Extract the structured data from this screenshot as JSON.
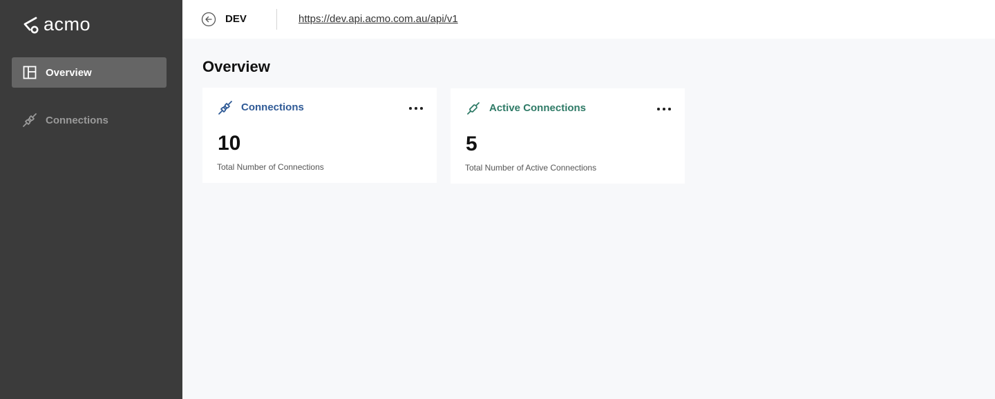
{
  "app": {
    "logo_text": "acmo"
  },
  "sidebar": {
    "items": [
      {
        "label": "Overview",
        "icon": "layout-icon",
        "active": true
      },
      {
        "label": "Connections",
        "icon": "plug-icon",
        "active": false
      }
    ]
  },
  "topbar": {
    "environment": "DEV",
    "api_url": "https://dev.api.acmo.com.au/api/v1"
  },
  "main": {
    "title": "Overview",
    "cards": [
      {
        "title": "Connections",
        "value": "10",
        "caption": "Total Number of Connections",
        "icon": "plug-icon",
        "color": "#2f5a96"
      },
      {
        "title": "Active Connections",
        "value": "5",
        "caption": "Total Number of Active Connections",
        "icon": "plug-icon",
        "color": "#2e7a66"
      }
    ]
  },
  "colors": {
    "sidebar_bg": "#3b3b3b",
    "sidebar_active": "#656565",
    "content_bg": "#f7f8fa",
    "connections_blue": "#2f5a96",
    "active_green": "#2e7a66"
  }
}
